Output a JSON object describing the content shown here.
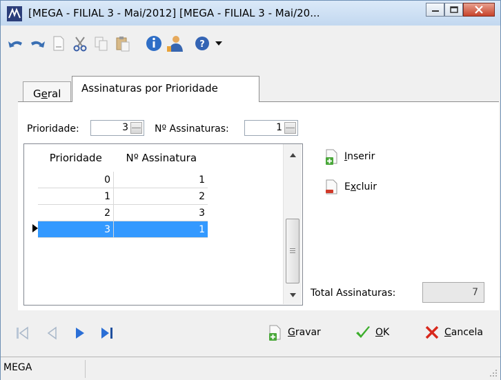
{
  "window": {
    "title": "[MEGA - FILIAL 3 - Mai/2012] [MEGA - FILIAL 3 - Mai/20..."
  },
  "toolbar": {
    "icons": [
      "undo-icon",
      "redo-icon",
      "new-document-icon",
      "cut-icon",
      "copy-icon",
      "paste-icon",
      "info-icon",
      "user-icon",
      "help-icon",
      "dropdown-arrow-icon"
    ]
  },
  "tabs": [
    {
      "label_pre": "G",
      "label_ul": "e",
      "label_post": "ral"
    },
    {
      "label": "Assinaturas por Prioridade"
    }
  ],
  "form": {
    "prioridade_label": "Prioridade:",
    "prioridade_value": "3",
    "num_assin_label": "Nº Assinaturas:",
    "num_assin_value": "1"
  },
  "grid": {
    "headers": [
      "Prioridade",
      "Nº Assinatura"
    ],
    "rows": [
      {
        "prioridade": "0",
        "assinatura": "1"
      },
      {
        "prioridade": "1",
        "assinatura": "2"
      },
      {
        "prioridade": "2",
        "assinatura": "3"
      },
      {
        "prioridade": "3",
        "assinatura": "1"
      }
    ]
  },
  "actions": {
    "inserir_ul": "I",
    "inserir_rest": "nserir",
    "excluir_pre": "E",
    "excluir_ul": "x",
    "excluir_rest": "cluir"
  },
  "total": {
    "label": "Total Assinaturas:",
    "value": "7"
  },
  "bottom": {
    "gravar_ul": "G",
    "gravar_rest": "ravar",
    "ok_ul": "O",
    "ok_rest": "K",
    "cancela_ul": "C",
    "cancela_rest": "ancela"
  },
  "status": {
    "text": "MEGA"
  },
  "colors": {
    "selection": "#3399ff",
    "titlebar": "#c2d8f0"
  }
}
